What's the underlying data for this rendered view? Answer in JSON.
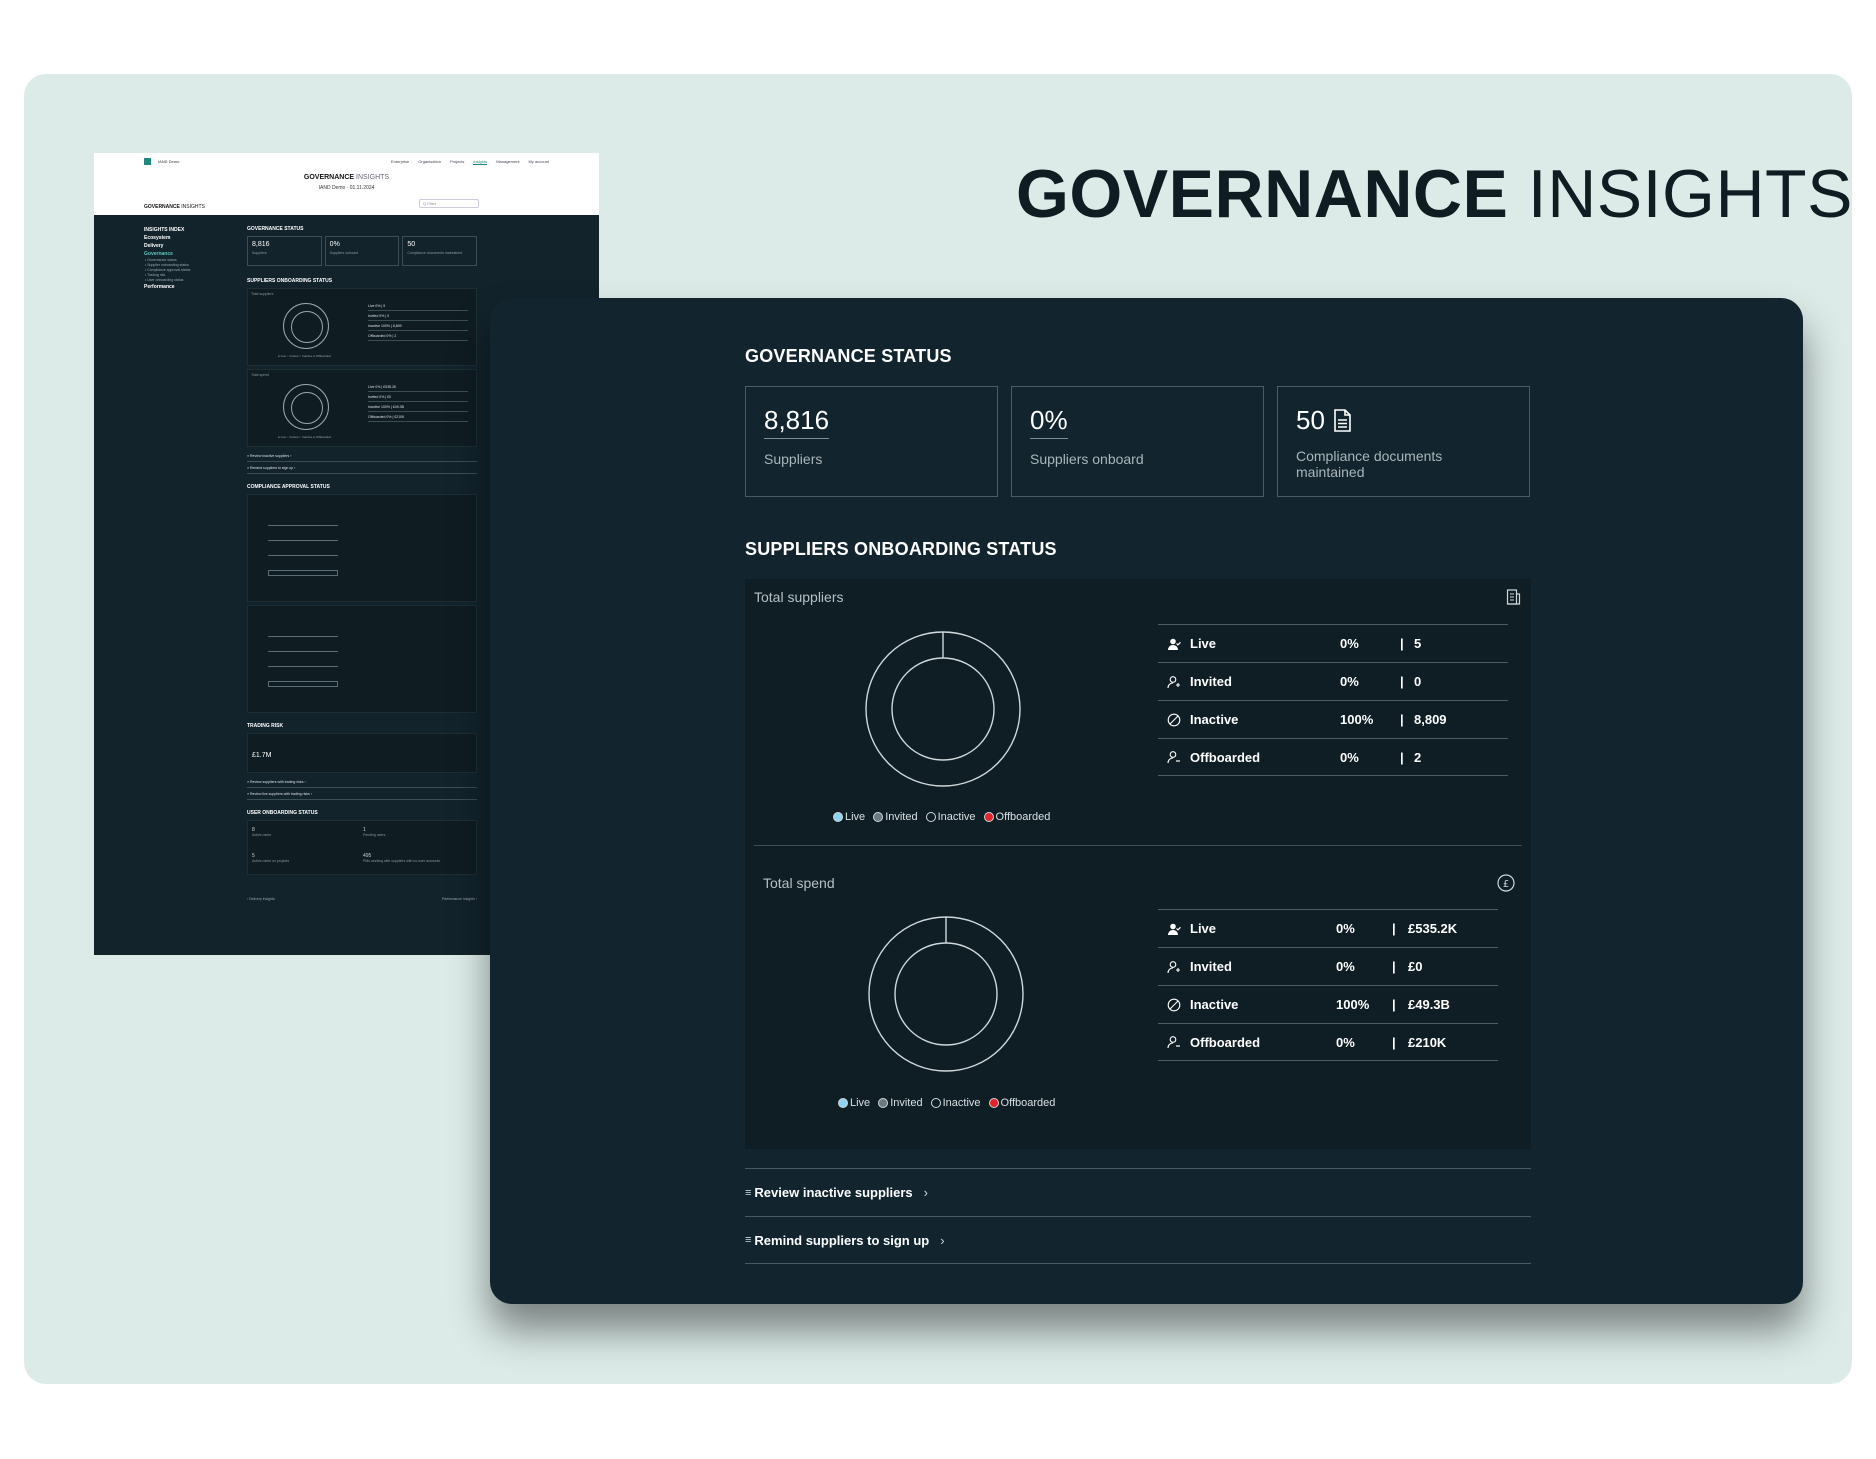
{
  "hero": {
    "bold": "GOVERNANCE",
    "light": "INSIGHTS"
  },
  "mini": {
    "brand": "IAND Demo",
    "nav": [
      "Enterprise",
      "Organisation",
      "Projects",
      "Insights",
      "Management",
      "My account"
    ],
    "title_bold": "GOVERNANCE",
    "title_light": "INSIGHTS",
    "subtitle": "IAND Demo · 01.11.2024",
    "section_bold": "GOVERNANCE",
    "section_light": "INSIGHTS",
    "search_placeholder": "Q Filter",
    "side_heading": "INSIGHTS INDEX",
    "side_items": [
      "Ecosystem",
      "Delivery",
      "Governance",
      "Performance"
    ],
    "side_sub": [
      "• Governance status",
      "• Supplier onboarding status",
      "• Compliance approval status",
      "• Trading risk",
      "• User onboarding status"
    ],
    "h_governance": "GOVERNANCE STATUS",
    "cards": [
      {
        "value": "8,816",
        "label": "Suppliers"
      },
      {
        "value": "0%",
        "label": "Suppliers onboard"
      },
      {
        "value": "50",
        "label": "Compliance documents maintained"
      }
    ],
    "h_onboarding": "SUPPLIERS ONBOARDING STATUS",
    "panel_total_suppliers": "Total suppliers",
    "panel_total_spend": "Total spend",
    "rows_a": [
      "Live   0%   |   5",
      "Invited   0%   |   0",
      "Inactive   100%   |   8,809",
      "Offboarded   0%   |   2"
    ],
    "rows_b": [
      "Live   0%   |   £535.2K",
      "Invited   0%   |   £0",
      "Inactive   100%   |   £49.3B",
      "Offboarded   0%   |   £210K"
    ],
    "legend": "● Live  ○ Invited  ○ Inactive  ● Offboarded",
    "links_a": [
      "≡ Review inactive suppliers ›",
      "≡ Remind suppliers to sign up ›"
    ],
    "h_compliance": "COMPLIANCE APPROVAL STATUS",
    "h_trading": "TRADING RISK",
    "trading_value": "£1.7M",
    "links_b": [
      "≡ Review suppliers with trading risks ›",
      "≡ Review live suppliers with trading risks ›"
    ],
    "h_user": "USER ONBOARDING STATUS",
    "user_stats": [
      {
        "value": "8",
        "label": "Active users"
      },
      {
        "value": "1",
        "label": "Pending users"
      },
      {
        "value": "5",
        "label": "Active users on projects"
      },
      {
        "value": "495",
        "label": "PMs working with suppliers with no user accounts"
      }
    ],
    "footer_left": "‹ Delivery insights",
    "footer_right": "Performance insights ›"
  },
  "governance": {
    "title": "GOVERNANCE STATUS",
    "cards": [
      {
        "value": "8,816",
        "label": "Suppliers",
        "icon": null
      },
      {
        "value": "0%",
        "label": "Suppliers onboard",
        "icon": null
      },
      {
        "value": "50",
        "label": "Compliance documents maintained",
        "icon": "document-icon"
      }
    ]
  },
  "onboarding": {
    "title": "SUPPLIERS ONBOARDING STATUS",
    "suppliers": {
      "title": "Total suppliers",
      "icon": "report-icon",
      "rows": [
        {
          "name": "Live",
          "pct": "0%",
          "sep": "|",
          "amount": "5",
          "icon": "live-user-icon"
        },
        {
          "name": "Invited",
          "pct": "0%",
          "sep": "|",
          "amount": "0",
          "icon": "invited-user-icon"
        },
        {
          "name": "Inactive",
          "pct": "100%",
          "sep": "|",
          "amount": "8,809",
          "icon": "inactive-icon"
        },
        {
          "name": "Offboarded",
          "pct": "0%",
          "sep": "|",
          "amount": "2",
          "icon": "offboarded-user-icon"
        }
      ],
      "shares": {
        "Live": 0.0006,
        "Invited": 0,
        "Inactive": 0.9992,
        "Offboarded": 0.0002
      }
    },
    "spend": {
      "title": "Total spend",
      "icon": "pound-icon",
      "rows": [
        {
          "name": "Live",
          "pct": "0%",
          "sep": "|",
          "amount": "£535.2K",
          "icon": "live-user-icon"
        },
        {
          "name": "Invited",
          "pct": "0%",
          "sep": "|",
          "amount": "£0",
          "icon": "invited-user-icon"
        },
        {
          "name": "Inactive",
          "pct": "100%",
          "sep": "|",
          "amount": "£49.3B",
          "icon": "inactive-icon"
        },
        {
          "name": "Offboarded",
          "pct": "0%",
          "sep": "|",
          "amount": "£210K",
          "icon": "offboarded-user-icon"
        }
      ]
    },
    "legend_a": [
      "Live",
      "Invited",
      "Inactive",
      "Offboarded"
    ],
    "legend_b": [
      "Live",
      "Invited",
      "Inactive",
      "Offboarded"
    ],
    "legend_colors": {
      "Live": "#8fd3f0",
      "Invited": "#6b7a80",
      "Inactive": "#0f1d24",
      "Offboarded": "#e0242b"
    }
  },
  "actions": [
    {
      "icon": "list-icon",
      "label": "Review inactive suppliers"
    },
    {
      "icon": "list-icon",
      "label": "Remind suppliers to sign up"
    }
  ]
}
